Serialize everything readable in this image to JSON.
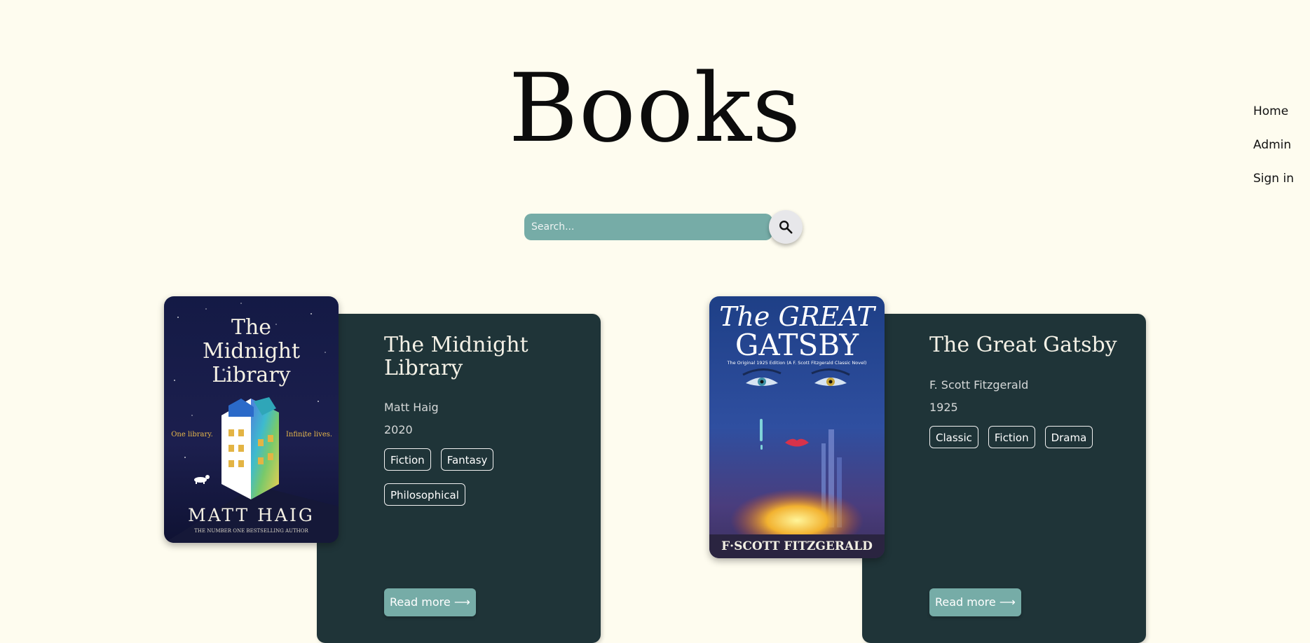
{
  "header": {
    "title": "Books"
  },
  "nav": {
    "home": "Home",
    "admin": "Admin",
    "signin": "Sign in"
  },
  "search": {
    "placeholder": "Search...",
    "value": ""
  },
  "books": [
    {
      "title": "The Midnight Library",
      "author": "Matt Haig",
      "year": "2020",
      "tags": [
        "Fiction",
        "Fantasy",
        "Philosophical"
      ],
      "read_more": "Read more ⟶",
      "cover": {
        "title_lines": [
          "The",
          "Midnight",
          "Library"
        ],
        "tagline_left": "One library.",
        "tagline_right": "Infinite lives.",
        "author": "MATT HAIG",
        "byline": "THE NUMBER ONE BESTSELLING AUTHOR"
      }
    },
    {
      "title": "The Great Gatsby",
      "author": "F. Scott Fitzgerald",
      "year": "1925",
      "tags": [
        "Classic",
        "Fiction",
        "Drama"
      ],
      "read_more": "Read more ⟶",
      "cover": {
        "title_line1": "The GREAT",
        "title_line2": "GATSBY",
        "subtitle": "The Original 1925 Edition  (A F. Scott Fitzgerald Classic Novel)",
        "author": "F·SCOTT FITZGERALD"
      }
    }
  ],
  "colors": {
    "background": "#fefcef",
    "card": "#1f3438",
    "accent": "#76aca7",
    "search_button": "#e7e7ea"
  }
}
